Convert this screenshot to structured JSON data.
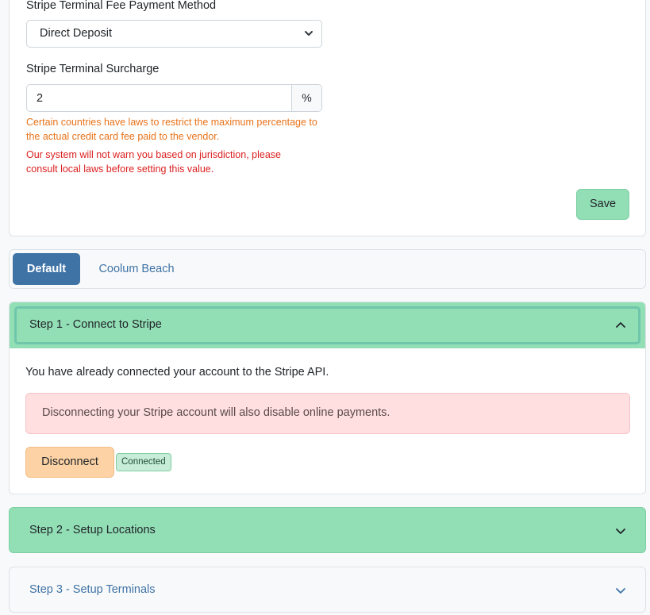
{
  "settings": {
    "fee_method_label": "Stripe Terminal Fee Payment Method",
    "fee_method_value": "Direct Deposit",
    "surcharge_label": "Stripe Terminal Surcharge",
    "surcharge_value": "2",
    "surcharge_unit": "%",
    "help_orange": "Certain countries have laws to restrict the maximum percentage to the actual credit card fee paid to the vendor.",
    "help_red": "Our system will not warn you based on jurisdiction, please consult local laws before setting this value.",
    "save_label": "Save"
  },
  "tabs": [
    {
      "label": "Default",
      "active": true
    },
    {
      "label": "Coolum Beach",
      "active": false
    }
  ],
  "step1": {
    "title": "Step 1 - Connect to Stripe",
    "expanded": true,
    "message": "You have already connected your account to the Stripe API.",
    "alert": "Disconnecting your Stripe account will also disable online payments.",
    "disconnect_label": "Disconnect",
    "status_badge": "Connected"
  },
  "step2": {
    "title": "Step 2 - Setup Locations",
    "expanded": false
  },
  "step3": {
    "title": "Step 3 - Setup Terminals",
    "expanded": false
  },
  "colors": {
    "primary": "#3f73a6",
    "success_light": "#92dfb6",
    "danger_light": "#ffdfdf",
    "warning_light": "#fdd3a5",
    "help_orange": "#e8731a",
    "help_red": "#dc1f1f"
  },
  "icons": {
    "select_chevron": "chevron-down-icon",
    "step1_chevron": "chevron-up-icon",
    "step2_chevron": "chevron-down-icon",
    "step3_chevron": "chevron-down-icon"
  }
}
